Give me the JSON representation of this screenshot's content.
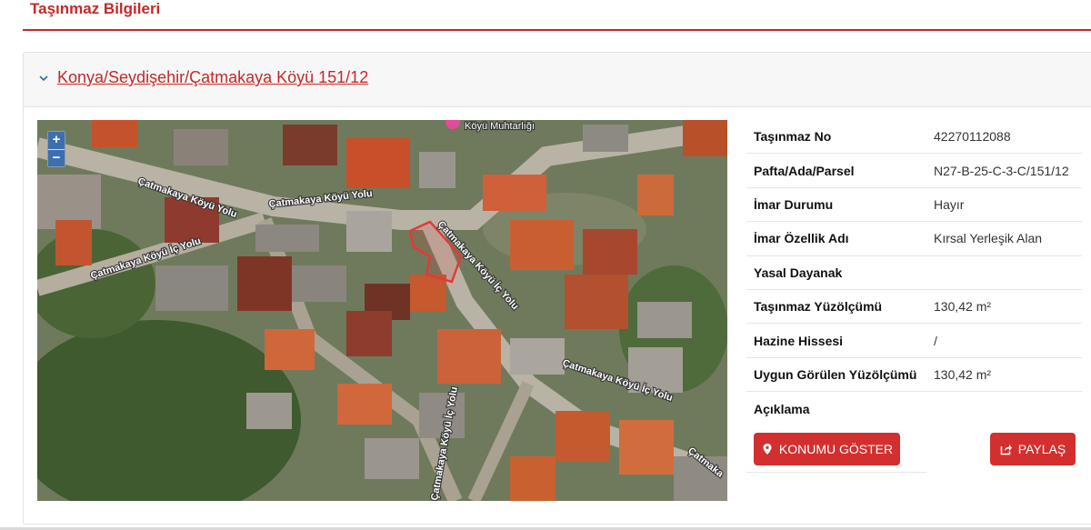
{
  "page": {
    "title": "Taşınmaz Bilgileri"
  },
  "parcel": {
    "heading": "Konya/Seydişehir/Çatmakaya Köyü 151/12"
  },
  "map": {
    "zoom_in": "+",
    "zoom_out": "−",
    "labels": {
      "road1a": "Çatmakaya Köyü Yolu",
      "road1b": "Çatmakaya Köyü Yolu",
      "road2": "Çatmakaya Köyü İç Yolu",
      "road3": "Çatmakaya Köyü İç Yolu",
      "road4": "Çatmakaya Köyü İç Yolu",
      "road5": "Çatmaka",
      "road6": "Çatmakaya Köyü İç Yolu",
      "poi": "Köyü Muhtarlığı"
    }
  },
  "info": {
    "rows": [
      {
        "label": "Taşınmaz No",
        "value": "42270112088"
      },
      {
        "label": "Pafta/Ada/Parsel",
        "value": "N27-B-25-C-3-C/151/12"
      },
      {
        "label": "İmar Durumu",
        "value": "Hayır"
      },
      {
        "label": "İmar Özellik Adı",
        "value": "Kırsal Yerleşik Alan"
      },
      {
        "label": "Yasal Dayanak",
        "value": ""
      },
      {
        "label": "Taşınmaz Yüzölçümü",
        "value": "130,42 m²"
      },
      {
        "label": "Hazine Hissesi",
        "value": "/"
      },
      {
        "label": "Uygun Görülen Yüzölçümü",
        "value": "130,42 m²"
      },
      {
        "label": "Açıklama",
        "value": ""
      }
    ]
  },
  "actions": {
    "show_location": "KONUMU GÖSTER",
    "share": "PAYLAŞ"
  },
  "colors": {
    "accent": "#c62828",
    "button": "#d32f2f",
    "parcel_outline": "#e53935"
  }
}
